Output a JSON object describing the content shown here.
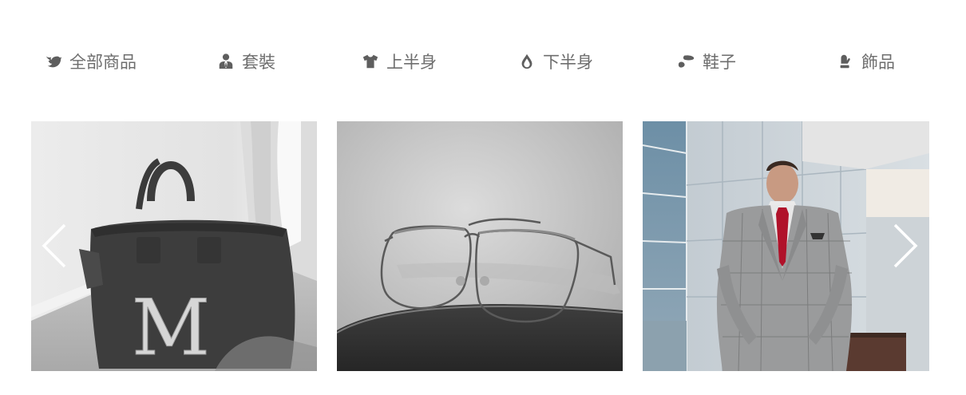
{
  "categories": [
    {
      "icon": "bird-icon",
      "label": "全部商品"
    },
    {
      "icon": "suit-person-icon",
      "label": "套裝"
    },
    {
      "icon": "tshirt-icon",
      "label": "上半身"
    },
    {
      "icon": "drop-icon",
      "label": "下半身"
    },
    {
      "icon": "shoes-icon",
      "label": "鞋子"
    },
    {
      "icon": "mitten-icon",
      "label": "飾品"
    }
  ],
  "carousel": {
    "slides": [
      {
        "subject": "gray tote bag with M monogram",
        "monogram": "M"
      },
      {
        "subject": "half-rim eyeglasses on a book"
      },
      {
        "subject": "man in gray checked suit with red tie"
      }
    ],
    "prev_icon": "chevron-left-icon",
    "next_icon": "chevron-right-icon"
  },
  "colors": {
    "nav_text": "#6e6e6e",
    "icon": "#5e5e5e",
    "arrow": "#ffffff",
    "tie": "#b0122a"
  }
}
